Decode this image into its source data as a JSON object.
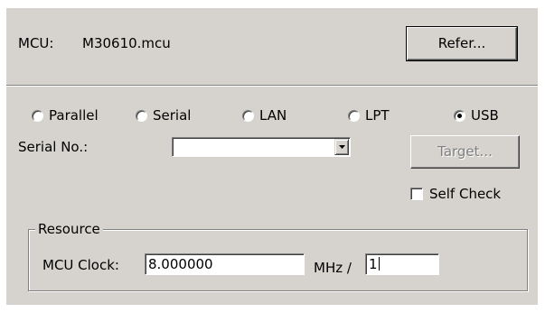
{
  "mcu": {
    "label": "MCU:",
    "file": "M30610.mcu",
    "refer_button": "Refer..."
  },
  "connection": {
    "options": [
      {
        "label": "Parallel",
        "selected": false
      },
      {
        "label": "Serial",
        "selected": false
      },
      {
        "label": "LAN",
        "selected": false
      },
      {
        "label": "LPT",
        "selected": false
      },
      {
        "label": "USB",
        "selected": true
      }
    ]
  },
  "serial": {
    "label": "Serial No.:",
    "value": "",
    "target_button": "Target...",
    "target_enabled": false
  },
  "self_check": {
    "label": "Self Check",
    "checked": false
  },
  "resource": {
    "title": "Resource",
    "clock_label": "MCU Clock:",
    "clock_value": "8.000000",
    "unit": "MHz /",
    "divider_value": "1"
  },
  "colors": {
    "dialog_bg": "#d6d3ce",
    "field_bg": "#ffffff",
    "disabled_text": "#808080"
  }
}
